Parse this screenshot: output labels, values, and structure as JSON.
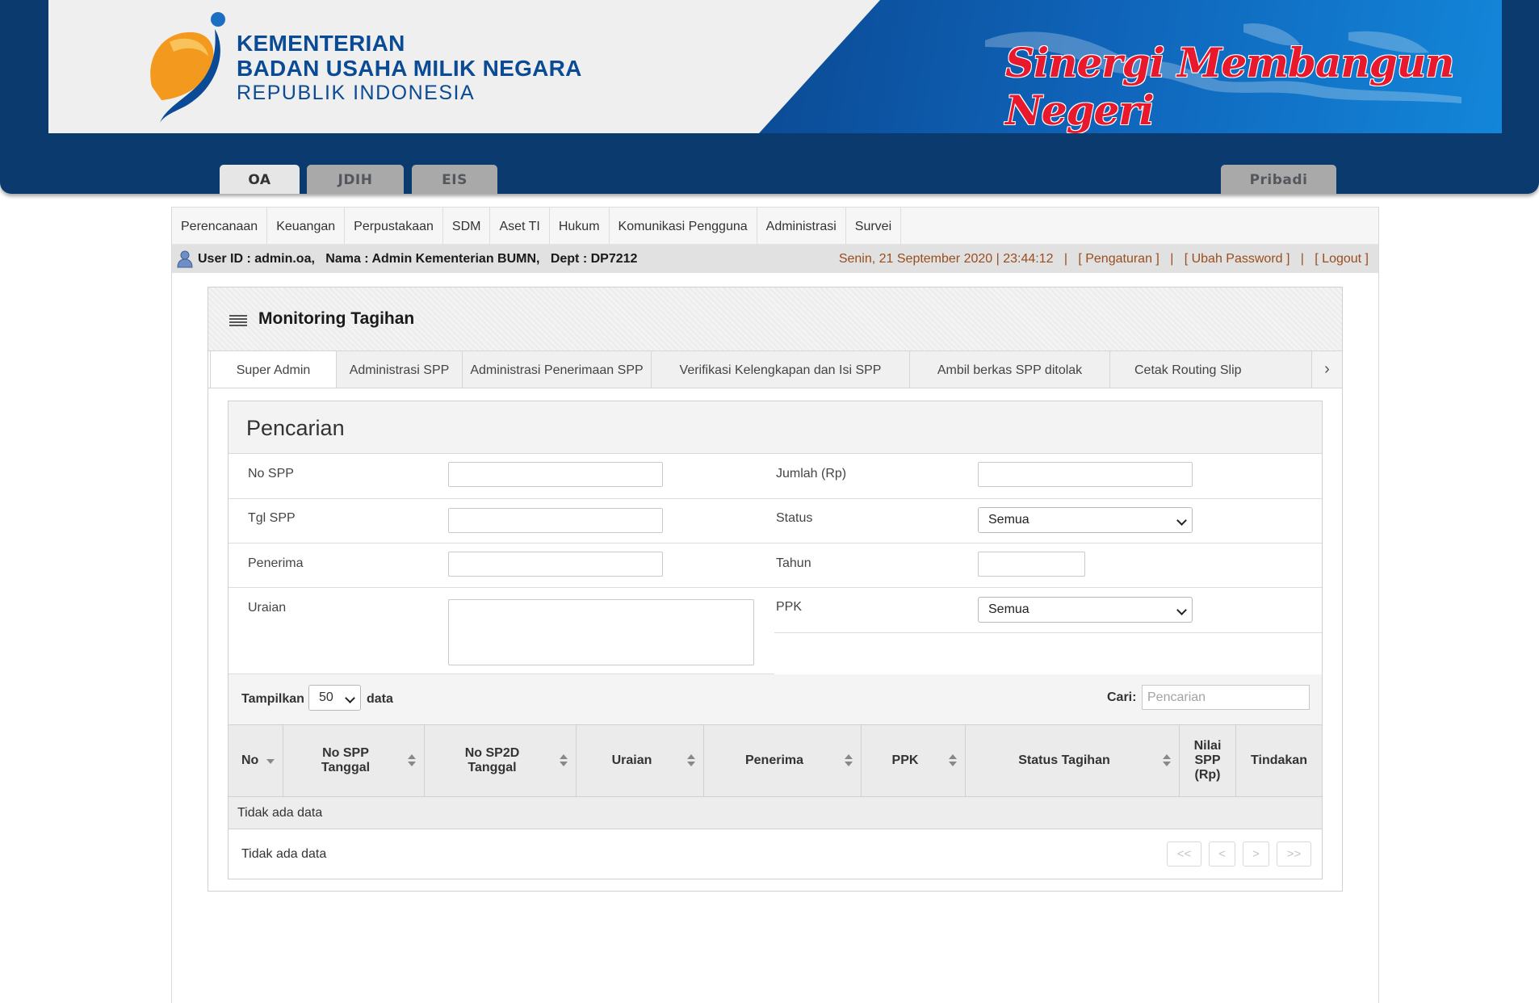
{
  "banner": {
    "ministry_line1": "KEMENTERIAN",
    "ministry_line2": "BADAN USAHA MILIK NEGARA",
    "ministry_line3": "REPUBLIK INDONESIA",
    "slogan": "Sinergi Membangun Negeri"
  },
  "main_tabs": [
    {
      "label": "OA",
      "active": true
    },
    {
      "label": "JDIH",
      "active": false
    },
    {
      "label": "EIS",
      "active": false
    }
  ],
  "personal_tab": "Pribadi",
  "menu": [
    "Perencanaan",
    "Keuangan",
    "Perpustakaan",
    "SDM",
    "Aset TI",
    "Hukum",
    "Komunikasi Pengguna",
    "Administrasi",
    "Survei"
  ],
  "userbar": {
    "user_info": "User ID : admin.oa,   Nama : Admin Kementerian BUMN,   Dept : DP7212",
    "datetime": "Senin, 21 September 2020 | 23:44:12",
    "sep": "|",
    "settings": "[ Pengaturan ]",
    "change_password": "[ Ubah Password ]",
    "logout": "[ Logout ]"
  },
  "panel": {
    "title": "Monitoring Tagihan",
    "tabs": [
      "Super Admin",
      "Administrasi SPP",
      "Administrasi Penerimaan SPP",
      "Verifikasi Kelengkapan dan Isi SPP",
      "Ambil berkas SPP ditolak",
      "Cetak Routing Slip"
    ]
  },
  "search": {
    "title": "Pencarian",
    "no_spp_label": "No SPP",
    "tgl_spp_label": "Tgl SPP",
    "penerima_label": "Penerima",
    "uraian_label": "Uraian",
    "jumlah_label": "Jumlah (Rp)",
    "status_label": "Status",
    "status_value": "Semua",
    "tahun_label": "Tahun",
    "ppk_label": "PPK",
    "ppk_value": "Semua"
  },
  "table": {
    "show_label": "Tampilkan",
    "page_length": "50",
    "data_label": "data",
    "search_label": "Cari:",
    "search_placeholder": "Pencarian",
    "columns": {
      "no": "No",
      "no_spp": "No SPP\nTanggal",
      "no_sp2d": "No SP2D\nTanggal",
      "uraian": "Uraian",
      "penerima": "Penerima",
      "ppk": "PPK",
      "status": "Status Tagihan",
      "nilai": "Nilai\nSPP\n(Rp)",
      "tindakan": "Tindakan"
    },
    "empty_text": "Tidak ada data",
    "info_text": "Tidak ada data",
    "pagination": [
      "<<",
      "<",
      ">",
      ">>"
    ]
  },
  "colors": {
    "header_blue": "#0b3a6e",
    "slogan_red": "#e8192c",
    "logo_orange": "#f08a16",
    "datetime_brown": "#9a4d1e"
  }
}
